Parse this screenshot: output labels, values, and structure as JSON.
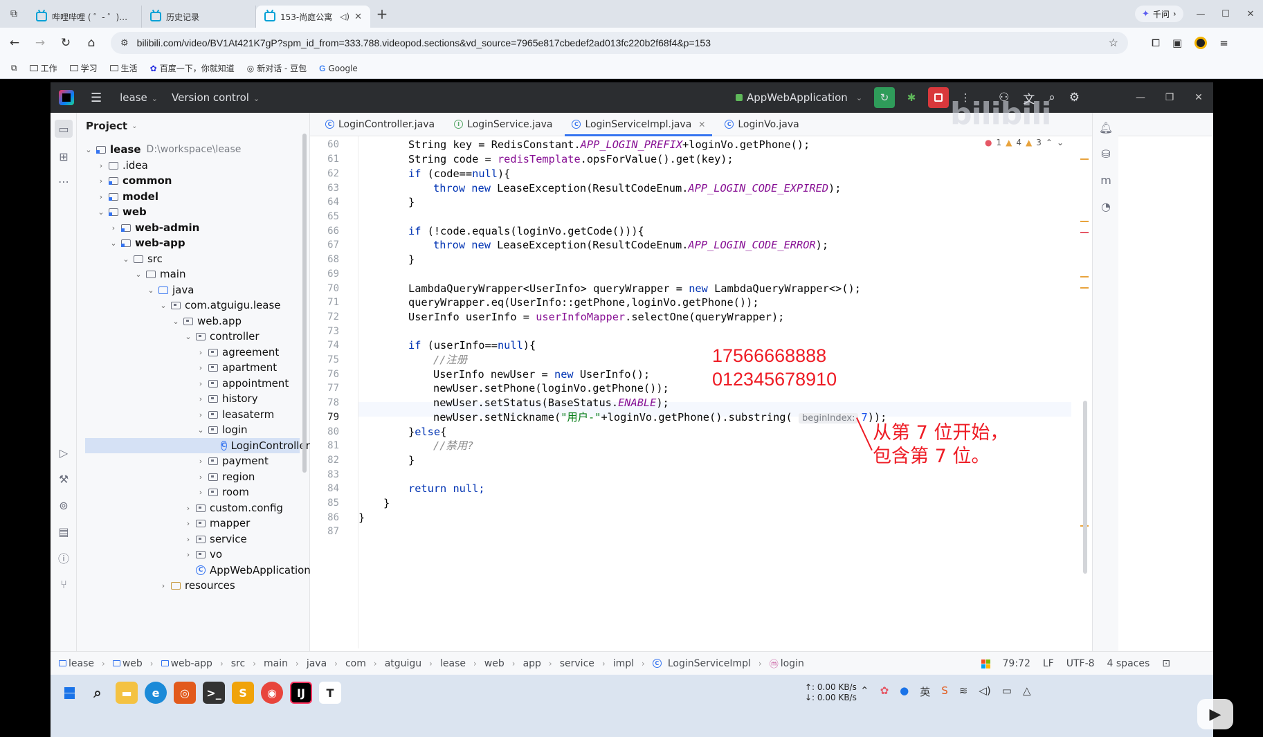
{
  "browser": {
    "tabs": [
      {
        "title": "哔哩哔哩 ( ゜- ゜)つロ",
        "active": false
      },
      {
        "title": "历史记录",
        "active": false
      },
      {
        "title": "153-尚庭公寓",
        "active": true
      }
    ],
    "qianwen_label": "千问",
    "url": "bilibili.com/video/BV1At421K7gP?spm_id_from=333.788.videopod.sections&vd_source=7965e817cbedef2ad013fc220b2f68f4&p=153",
    "bookmarks": [
      "工作",
      "学习",
      "生活",
      "百度一下，你就知道",
      "新对话 - 豆包",
      "Google"
    ]
  },
  "ide": {
    "project_name": "lease",
    "vcs_label": "Version control",
    "run_config": "AppWebApplication",
    "panel_title": "Project",
    "tree": [
      {
        "label": "lease",
        "extra": "D:\\workspace\\lease",
        "bold": true
      },
      {
        "label": ".idea"
      },
      {
        "label": "common",
        "bold": true
      },
      {
        "label": "model",
        "bold": true
      },
      {
        "label": "web",
        "bold": true
      },
      {
        "label": "web-admin",
        "bold": true
      },
      {
        "label": "web-app",
        "bold": true
      },
      {
        "label": "src"
      },
      {
        "label": "main"
      },
      {
        "label": "java"
      },
      {
        "label": "com.atguigu.lease"
      },
      {
        "label": "web.app"
      },
      {
        "label": "controller"
      },
      {
        "label": "agreement"
      },
      {
        "label": "apartment"
      },
      {
        "label": "appointment"
      },
      {
        "label": "history"
      },
      {
        "label": "leasaterm"
      },
      {
        "label": "login"
      },
      {
        "label": "LoginController"
      },
      {
        "label": "payment"
      },
      {
        "label": "region"
      },
      {
        "label": "room"
      },
      {
        "label": "custom.config"
      },
      {
        "label": "mapper"
      },
      {
        "label": "service"
      },
      {
        "label": "vo"
      },
      {
        "label": "AppWebApplication"
      },
      {
        "label": "resources"
      }
    ],
    "editor_tabs": [
      {
        "label": "LoginController.java"
      },
      {
        "label": "LoginService.java"
      },
      {
        "label": "LoginServiceImpl.java"
      },
      {
        "label": "LoginVo.java"
      }
    ],
    "inspections": {
      "errors": "1",
      "warnings": "4",
      "weak": "3"
    },
    "line_numbers": [
      "60",
      "61",
      "62",
      "63",
      "64",
      "65",
      "66",
      "67",
      "68",
      "69",
      "70",
      "71",
      "72",
      "73",
      "74",
      "75",
      "76",
      "77",
      "78",
      "79",
      "80",
      "81",
      "82",
      "83",
      "84",
      "85",
      "86",
      "87"
    ],
    "code": {
      "l60a": "String key = RedisConstant.",
      "l60b": "APP_LOGIN_PREFIX",
      "l60c": "+loginVo.getPhone();",
      "l61a": "String code = ",
      "l61b": "redisTemplate",
      "l61c": ".opsForValue().get(key);",
      "l62a": "if",
      "l62b": " (code==",
      "l62c": "null",
      "l62d": "){",
      "l63a": "throw",
      "l63b": " ",
      "l63c": "new",
      "l63d": " LeaseException(ResultCodeEnum.",
      "l63e": "APP_LOGIN_CODE_EXPIRED",
      "l63f": ");",
      "l64": "}",
      "l66a": "if",
      "l66b": " (!code.equals(loginVo.getCode())){",
      "l67a": "throw",
      "l67c": "new",
      "l67d": " LeaseException(ResultCodeEnum.",
      "l67e": "APP_LOGIN_CODE_ERROR",
      "l67f": ");",
      "l68": "}",
      "l70a": "LambdaQueryWrapper<UserInfo> queryWrapper = ",
      "l70b": "new",
      "l70c": " LambdaQueryWrapper<>();",
      "l71": "queryWrapper.eq(UserInfo::getPhone,loginVo.getPhone());",
      "l72a": "UserInfo userInfo = ",
      "l72b": "userInfoMapper",
      "l72c": ".selectOne(queryWrapper);",
      "l74a": "if",
      "l74b": " (userInfo==",
      "l74c": "null",
      "l74d": "){",
      "l75": "//注册",
      "l76a": "UserInfo newUser = ",
      "l76b": "new",
      "l76c": " UserInfo();",
      "l77": "newUser.setPhone(loginVo.getPhone());",
      "l78a": "newUser.setStatus(BaseStatus.",
      "l78b": "ENABLE",
      "l78c": ");",
      "l79a": "newUser.setNickname(",
      "l79b": "\"用户-\"",
      "l79c": "+loginVo.getPhone().substring(",
      "l79hint": "beginIndex:",
      "l79d": "7",
      "l79e": "));",
      "l80a": "}",
      "l80b": "else",
      "l80c": "{",
      "l81": "//禁用?",
      "l82": "}",
      "l84a": "return",
      "l84b": " null;",
      "l85": "}",
      "l86": "}"
    },
    "annotation": {
      "phone": "17566668888",
      "digits": "012345678910",
      "note_line1": "从第 7 位开始，",
      "note_line2": "包含第 7 位。"
    },
    "breadcrumbs": [
      "lease",
      "web",
      "web-app",
      "src",
      "main",
      "java",
      "com",
      "atguigu",
      "lease",
      "web",
      "app",
      "service",
      "impl",
      "LoginServiceImpl",
      "login"
    ],
    "status": {
      "position": "79:72",
      "line_sep": "LF",
      "encoding": "UTF-8",
      "indent": "4 spaces"
    },
    "net_up": "↑: 0.00 KB/s",
    "net_down": "↓: 0.00 KB/s",
    "accent": "#3574f0",
    "annotation_color": "#ee1c25"
  }
}
